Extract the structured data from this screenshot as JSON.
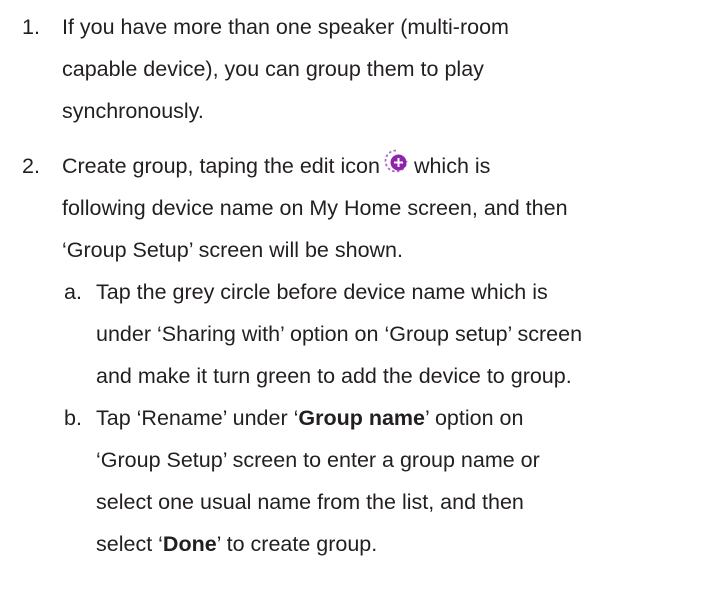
{
  "steps": [
    {
      "number": "1.",
      "lines": [
        "If you have more than one speaker (multi-room",
        "capable device), you can group them to play",
        "synchronously."
      ]
    },
    {
      "number": "2.",
      "line1_before_icon": "Create group, taping the edit icon",
      "line1_after_icon": "which is",
      "lines": [
        "following device name on My Home screen, and then",
        "‘Group Setup’ screen will be shown."
      ]
    }
  ],
  "substeps": [
    {
      "letter": "a.",
      "lines": [
        "Tap the grey circle before device name which is",
        "under ‘Sharing with’ option on ‘Group setup’ screen",
        "and make it turn green to add the device to group."
      ]
    },
    {
      "letter": "b.",
      "line1_pre": "Tap ‘Rename’ under ‘",
      "line1_bold": "Group name",
      "line1_post": "’ option on",
      "lines": [
        "‘Group Setup’ screen to enter a group name or",
        "select one usual name from the list, and then"
      ],
      "last_pre": "select ‘",
      "last_bold": "Done",
      "last_post": "’ to create group."
    }
  ],
  "icons": {
    "edit_icon": "edit-group-icon",
    "edit_icon_color": "#8e24aa"
  }
}
